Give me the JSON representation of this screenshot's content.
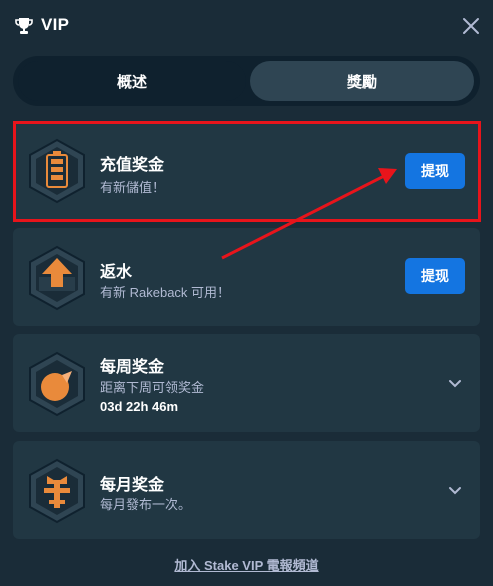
{
  "header": {
    "title": "VIP",
    "trophy_icon": "trophy-icon",
    "close_icon": "close-icon"
  },
  "tabs": [
    {
      "label": "概述",
      "active": false
    },
    {
      "label": "獎勵",
      "active": true
    }
  ],
  "rewards": {
    "reload": {
      "title": "充值奖金",
      "subtitle": "有新儲值！",
      "button": "提现",
      "icon": "battery-icon"
    },
    "rakeback": {
      "title": "返水",
      "subtitle": "有新 Rakeback 可用！",
      "button": "提现",
      "icon": "upload-arrow-icon"
    },
    "weekly": {
      "title": "每周奖金",
      "subtitle": "距离下周可领奖金",
      "timer": "03d 22h 46m",
      "icon": "coin-icon"
    },
    "monthly": {
      "title": "每月奖金",
      "subtitle": "每月發布一次。",
      "icon": "gift-icon"
    }
  },
  "footer": {
    "link": "加入 Stake VIP 電報頻道"
  },
  "colors": {
    "background": "#1a2c38",
    "card": "#213743",
    "accent_button": "#1475e1",
    "highlight": "#e8141b",
    "badge_orange": "#e98a3b"
  }
}
